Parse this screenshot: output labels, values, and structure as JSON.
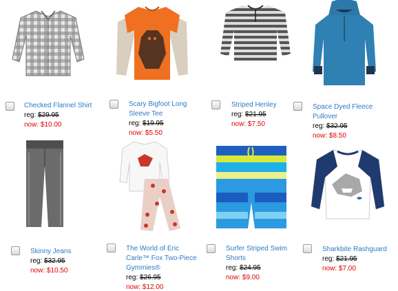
{
  "products": [
    {
      "name": "Checked Flannel Shirt",
      "reg_label": "reg:",
      "reg_price": "$29.95",
      "now_label": "now:",
      "now_price": "$10.00"
    },
    {
      "name": "Scary Bigfoot Long Sleeve Tee",
      "reg_label": "reg:",
      "reg_price": "$19.95",
      "now_label": "now:",
      "now_price": "$5.50"
    },
    {
      "name": "Striped Henley",
      "reg_label": "reg:",
      "reg_price": "$21.95",
      "now_label": "now:",
      "now_price": "$7.50"
    },
    {
      "name": "Space Dyed Fleece Pullover",
      "reg_label": "reg:",
      "reg_price": "$32.95",
      "now_label": "now:",
      "now_price": "$8.50"
    },
    {
      "name": "Skinny Jeans",
      "reg_label": "reg:",
      "reg_price": "$32.95",
      "now_label": "now:",
      "now_price": "$10.50"
    },
    {
      "name": "The World of Eric Carle™ Fox Two-Piece Gymmies®",
      "reg_label": "reg:",
      "reg_price": "$26.95",
      "now_label": "now:",
      "now_price": "$12.00"
    },
    {
      "name": "Surfer Striped Swim Shorts",
      "reg_label": "reg:",
      "reg_price": "$24.95",
      "now_label": "now:",
      "now_price": "$9.00"
    },
    {
      "name": "Sharkbite Rashguard",
      "reg_label": "reg:",
      "reg_price": "$21.95",
      "now_label": "now:",
      "now_price": "$7.00"
    }
  ],
  "colors": {
    "link": "#2e79c8",
    "sale": "#e00000"
  }
}
